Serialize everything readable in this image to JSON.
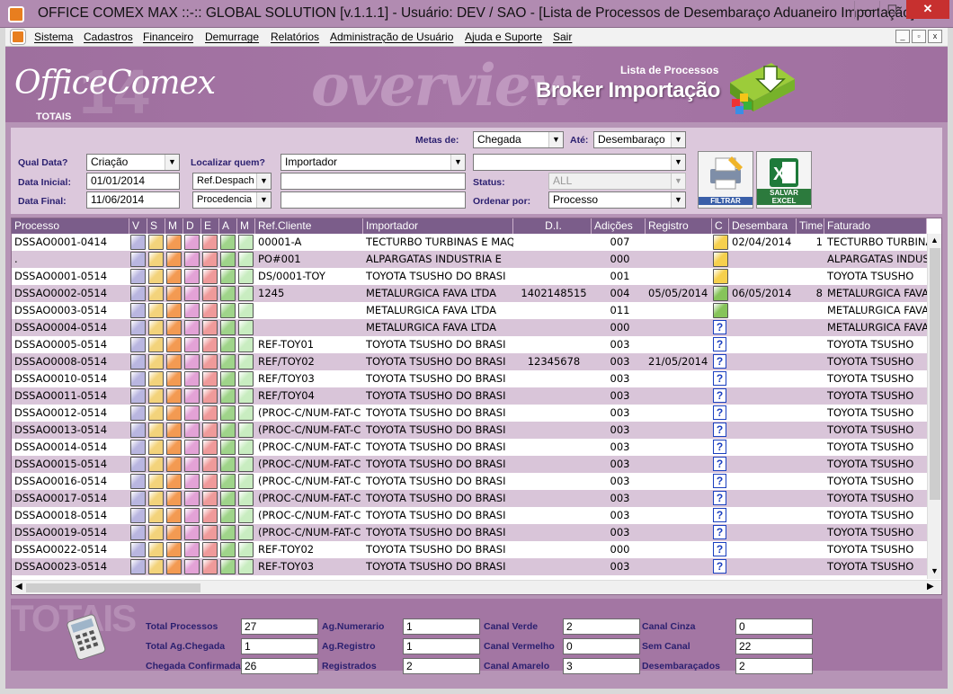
{
  "window": {
    "title": "OFFICE COMEX MAX ::-:: GLOBAL SOLUTION [v.1.1.1] - Usuário: DEV / SAO - [Lista de Processos de Desembaraço Aduaneiro Importação]",
    "min": "—",
    "max": "☐",
    "close": "✕"
  },
  "menu": {
    "items": [
      "Sistema",
      "Cadastros",
      "Financeiro",
      "Demurrage",
      "Relatórios",
      "Administração de Usuário",
      "Ajuda e Suporte",
      "Sair"
    ],
    "mdi": [
      "_",
      "▫",
      "x"
    ]
  },
  "banner": {
    "logo": "OfficeComex",
    "logo_num": "14",
    "watermark": "overview",
    "subtitle": "Lista de Processos",
    "title": "Broker Importação"
  },
  "filters": {
    "metas_label": "Metas de:",
    "metas_value": "Chegada",
    "ate_label": "Até:",
    "ate_value": "Desembaraço",
    "qual_data_label": "Qual Data?",
    "qual_data_value": "Criação",
    "localizar_label": "Localizar quem?",
    "localizar_value": "Importador",
    "importador_value": "",
    "blank_select": "",
    "data_inicial_label": "Data Inicial:",
    "data_inicial_value": "01/01/2014",
    "ref_value": "Ref.Despach",
    "ref_input": "",
    "status_label": "Status:",
    "status_value": "ALL",
    "data_final_label": "Data Final:",
    "data_final_value": "11/06/2014",
    "proc_value": "Procedencia",
    "proc_input": "",
    "ordenar_label": "Ordenar por:",
    "ordenar_value": "Processo",
    "filtrar_label": "FILTRAR",
    "excel_label": "SALVAR EXCEL"
  },
  "grid": {
    "headers": [
      "Processo",
      "V",
      "S",
      "M",
      "D",
      "E",
      "A",
      "M",
      "Ref.Cliente",
      "Importador",
      "D.I.",
      "Adições",
      "Registro",
      "C",
      "Desembara",
      "Time",
      "Faturado"
    ],
    "status_colors": [
      "#b9b6e0",
      "#f3d37b",
      "#f39a52",
      "#e3a2d6",
      "#ef9a9a",
      "#9fd48a",
      "#c9edc1"
    ],
    "rows": [
      {
        "processo": "DSSAO0001-0414",
        "ref": "00001-A",
        "importador": "TECTURBO TURBINAS E MAQ",
        "di": "",
        "adicoes": "007",
        "registro": "",
        "c": "yellow",
        "desemb": "02/04/2014",
        "time": "1",
        "faturado": "TECTURBO TURBINAS"
      },
      {
        "processo": ".",
        "ref": "PO#001",
        "importador": "ALPARGATAS INDUSTRIA E",
        "di": "",
        "adicoes": "000",
        "registro": "",
        "c": "yellow",
        "desemb": "",
        "time": "",
        "faturado": "ALPARGATAS INDUSTRIA"
      },
      {
        "processo": "DSSAO0001-0514",
        "ref": "DS/0001-TOY",
        "importador": "TOYOTA TSUSHO DO BRASI",
        "di": "",
        "adicoes": "001",
        "registro": "",
        "c": "yellow",
        "desemb": "",
        "time": "",
        "faturado": "TOYOTA TSUSHO"
      },
      {
        "processo": "DSSAO0002-0514",
        "ref": "1245",
        "importador": "METALURGICA FAVA LTDA",
        "di": "1402148515",
        "adicoes": "004",
        "registro": "05/05/2014",
        "c": "green",
        "desemb": "06/05/2014",
        "time": "8",
        "faturado": "METALURGICA FAVA"
      },
      {
        "processo": "DSSAO0003-0514",
        "ref": "",
        "importador": "METALURGICA FAVA LTDA",
        "di": "",
        "adicoes": "011",
        "registro": "",
        "c": "green",
        "desemb": "",
        "time": "",
        "faturado": "METALURGICA FAVA"
      },
      {
        "processo": "DSSAO0004-0514",
        "ref": "",
        "importador": "METALURGICA FAVA LTDA",
        "di": "",
        "adicoes": "000",
        "registro": "",
        "c": "q",
        "desemb": "",
        "time": "",
        "faturado": "METALURGICA FAVA"
      },
      {
        "processo": "DSSAO0005-0514",
        "ref": "REF-TOY01",
        "importador": "TOYOTA TSUSHO DO BRASI",
        "di": "",
        "adicoes": "003",
        "registro": "",
        "c": "q",
        "desemb": "",
        "time": "",
        "faturado": "TOYOTA TSUSHO"
      },
      {
        "processo": "DSSAO0008-0514",
        "ref": "REF/TOY02",
        "importador": "TOYOTA TSUSHO DO BRASI",
        "di": "12345678",
        "adicoes": "003",
        "registro": "21/05/2014",
        "c": "q",
        "desemb": "",
        "time": "",
        "faturado": "TOYOTA TSUSHO"
      },
      {
        "processo": "DSSAO0010-0514",
        "ref": "REF/TOY03",
        "importador": "TOYOTA TSUSHO DO BRASI",
        "di": "",
        "adicoes": "003",
        "registro": "",
        "c": "q",
        "desemb": "",
        "time": "",
        "faturado": "TOYOTA TSUSHO"
      },
      {
        "processo": "DSSAO0011-0514",
        "ref": "REF/TOY04",
        "importador": "TOYOTA TSUSHO DO BRASI",
        "di": "",
        "adicoes": "003",
        "registro": "",
        "c": "q",
        "desemb": "",
        "time": "",
        "faturado": "TOYOTA TSUSHO"
      },
      {
        "processo": "DSSAO0012-0514",
        "ref": "(PROC-C/NUM-FAT-C",
        "importador": "TOYOTA TSUSHO DO BRASI",
        "di": "",
        "adicoes": "003",
        "registro": "",
        "c": "q",
        "desemb": "",
        "time": "",
        "faturado": "TOYOTA TSUSHO"
      },
      {
        "processo": "DSSAO0013-0514",
        "ref": "(PROC-C/NUM-FAT-C",
        "importador": "TOYOTA TSUSHO DO BRASI",
        "di": "",
        "adicoes": "003",
        "registro": "",
        "c": "q",
        "desemb": "",
        "time": "",
        "faturado": "TOYOTA TSUSHO"
      },
      {
        "processo": "DSSAO0014-0514",
        "ref": "(PROC-C/NUM-FAT-C",
        "importador": "TOYOTA TSUSHO DO BRASI",
        "di": "",
        "adicoes": "003",
        "registro": "",
        "c": "q",
        "desemb": "",
        "time": "",
        "faturado": "TOYOTA TSUSHO"
      },
      {
        "processo": "DSSAO0015-0514",
        "ref": "(PROC-C/NUM-FAT-C",
        "importador": "TOYOTA TSUSHO DO BRASI",
        "di": "",
        "adicoes": "003",
        "registro": "",
        "c": "q",
        "desemb": "",
        "time": "",
        "faturado": "TOYOTA TSUSHO"
      },
      {
        "processo": "DSSAO0016-0514",
        "ref": "(PROC-C/NUM-FAT-C",
        "importador": "TOYOTA TSUSHO DO BRASI",
        "di": "",
        "adicoes": "003",
        "registro": "",
        "c": "q",
        "desemb": "",
        "time": "",
        "faturado": "TOYOTA TSUSHO"
      },
      {
        "processo": "DSSAO0017-0514",
        "ref": "(PROC-C/NUM-FAT-C",
        "importador": "TOYOTA TSUSHO DO BRASI",
        "di": "",
        "adicoes": "003",
        "registro": "",
        "c": "q",
        "desemb": "",
        "time": "",
        "faturado": "TOYOTA TSUSHO"
      },
      {
        "processo": "DSSAO0018-0514",
        "ref": "(PROC-C/NUM-FAT-C",
        "importador": "TOYOTA TSUSHO DO BRASI",
        "di": "",
        "adicoes": "003",
        "registro": "",
        "c": "q",
        "desemb": "",
        "time": "",
        "faturado": "TOYOTA TSUSHO"
      },
      {
        "processo": "DSSAO0019-0514",
        "ref": "(PROC-C/NUM-FAT-C",
        "importador": "TOYOTA TSUSHO DO BRASI",
        "di": "",
        "adicoes": "003",
        "registro": "",
        "c": "q",
        "desemb": "",
        "time": "",
        "faturado": "TOYOTA TSUSHO"
      },
      {
        "processo": "DSSAO0022-0514",
        "ref": "REF-TOY02",
        "importador": "TOYOTA TSUSHO DO BRASI",
        "di": "",
        "adicoes": "000",
        "registro": "",
        "c": "q",
        "desemb": "",
        "time": "",
        "faturado": "TOYOTA TSUSHO"
      },
      {
        "processo": "DSSAO0023-0514",
        "ref": "REF-TOY03",
        "importador": "TOYOTA TSUSHO DO BRASI",
        "di": "",
        "adicoes": "003",
        "registro": "",
        "c": "q",
        "desemb": "",
        "time": "",
        "faturado": "TOYOTA TSUSHO"
      }
    ]
  },
  "totals": {
    "watermark": "TOTAIS",
    "label": "TOTAIS",
    "fields": [
      {
        "label": "Total Processos",
        "value": "27"
      },
      {
        "label": "Total Ag.Chegada",
        "value": "1"
      },
      {
        "label": "Chegada Confirmada",
        "value": "26"
      },
      {
        "label": "Ag.Numerario",
        "value": "1"
      },
      {
        "label": "Ag.Registro",
        "value": "1"
      },
      {
        "label": "Registrados",
        "value": "2"
      },
      {
        "label": "Canal Verde",
        "value": "2"
      },
      {
        "label": "Canal Vermelho",
        "value": "0"
      },
      {
        "label": "Canal Amarelo",
        "value": "3"
      },
      {
        "label": "Canal Cinza",
        "value": "0"
      },
      {
        "label": "Sem Canal",
        "value": "22"
      },
      {
        "label": "Desembaraçados",
        "value": "2"
      }
    ]
  }
}
